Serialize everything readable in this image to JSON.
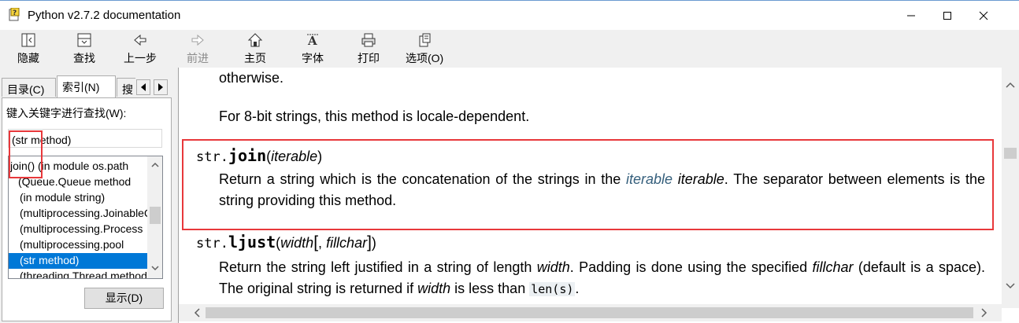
{
  "window": {
    "title": "Python v2.7.2 documentation",
    "icon": "python-help-file-icon",
    "controls": [
      "minimize-icon",
      "maximize-icon",
      "close-icon"
    ]
  },
  "toolbar": {
    "buttons": [
      {
        "label": "隐藏",
        "icon": "hide-pane-icon",
        "enabled": true
      },
      {
        "label": "查找",
        "icon": "locate-icon",
        "enabled": true
      },
      {
        "label": "上一步",
        "icon": "back-arrow-icon",
        "enabled": true
      },
      {
        "label": "前进",
        "icon": "forward-arrow-icon",
        "enabled": false
      },
      {
        "label": "主页",
        "icon": "home-icon",
        "enabled": true
      },
      {
        "label": "字体",
        "icon": "font-icon",
        "enabled": true
      },
      {
        "label": "打印",
        "icon": "printer-icon",
        "enabled": true
      },
      {
        "label": "选项(O)",
        "icon": "options-icon",
        "enabled": true
      }
    ]
  },
  "sidebar": {
    "tabs": [
      {
        "label": "目录(C)",
        "active": false
      },
      {
        "label": "索引(N)",
        "active": true
      },
      {
        "label": "搜",
        "active": false
      }
    ],
    "search_label": "键入关键字进行查找(W):",
    "search_value": "(str method)",
    "index_items": [
      {
        "prefix": "join()",
        "text": " (in module os.path",
        "indent": false,
        "selected": false
      },
      {
        "prefix": "",
        "text": "(Queue.Queue method",
        "indent": true,
        "selected": false
      },
      {
        "prefix": "",
        "text": "(in module string)",
        "indent": true,
        "selected": false
      },
      {
        "prefix": "",
        "text": "(multiprocessing.JoinableQueue",
        "indent": true,
        "selected": false
      },
      {
        "prefix": "",
        "text": "(multiprocessing.Process",
        "indent": true,
        "selected": false
      },
      {
        "prefix": "",
        "text": "(multiprocessing.pool",
        "indent": true,
        "selected": false
      },
      {
        "prefix": "",
        "text": "(str method)",
        "indent": true,
        "selected": true
      },
      {
        "prefix": "",
        "text": "(threading.Thread method",
        "indent": true,
        "selected": false
      }
    ],
    "display_button": "显示(D)"
  },
  "content": {
    "para_prev_end": "otherwise.",
    "para_locale": "For 8-bit strings, this method is locale-dependent.",
    "join": {
      "class_prefix": "str.",
      "name": "join",
      "open": "(",
      "param": "iterable",
      "close": ")",
      "desc_before": "Return a string which is the concatenation of the strings in the ",
      "desc_link": "iterable",
      "desc_param": "iterable",
      "desc_after": ". The separator between elements is the string providing this method."
    },
    "ljust": {
      "class_prefix": "str.",
      "name": "ljust",
      "open": "(",
      "param1": "width",
      "bracket_open": "[",
      "comma": ", ",
      "param2": "fillchar",
      "bracket_close": "]",
      "close": ")",
      "desc_1": "Return the string left justified in a string of length ",
      "desc_width": "width",
      "desc_2": ". Padding is done using the specified ",
      "desc_fillchar": "fillchar",
      "desc_3": " (default is a space). The original string is returned if ",
      "desc_width2": "width",
      "desc_4": " is less than ",
      "desc_code": "len(s)",
      "desc_5": "."
    }
  },
  "colors": {
    "annotation_red": "#e8383b",
    "selection_blue": "#0078d7",
    "link_blue": "#355f7c"
  }
}
